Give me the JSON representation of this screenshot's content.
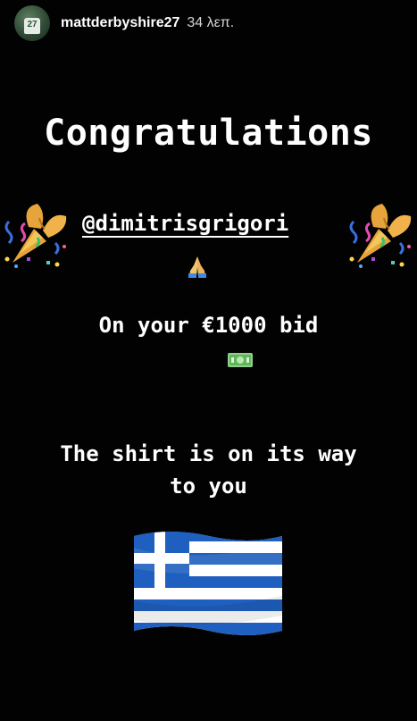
{
  "header": {
    "avatar_number": "27",
    "username": "mattderbyshire27",
    "timestamp": "34 λεπ."
  },
  "content": {
    "title": "Congratulations",
    "mention": "@dimitrisgrigori",
    "bid_text": "On your €1000 bid",
    "shirt_line1": "The shirt is on its way",
    "shirt_line2": "to you"
  },
  "emojis": {
    "left_popper": "party-popper",
    "right_popper": "party-popper",
    "hands": "folded-hands",
    "money": "banknote",
    "flag": "greek-flag"
  },
  "colors": {
    "background": "#020202",
    "text": "#ffffff",
    "flag_blue": "#1f5fbf",
    "gold": "#e8a83a"
  }
}
